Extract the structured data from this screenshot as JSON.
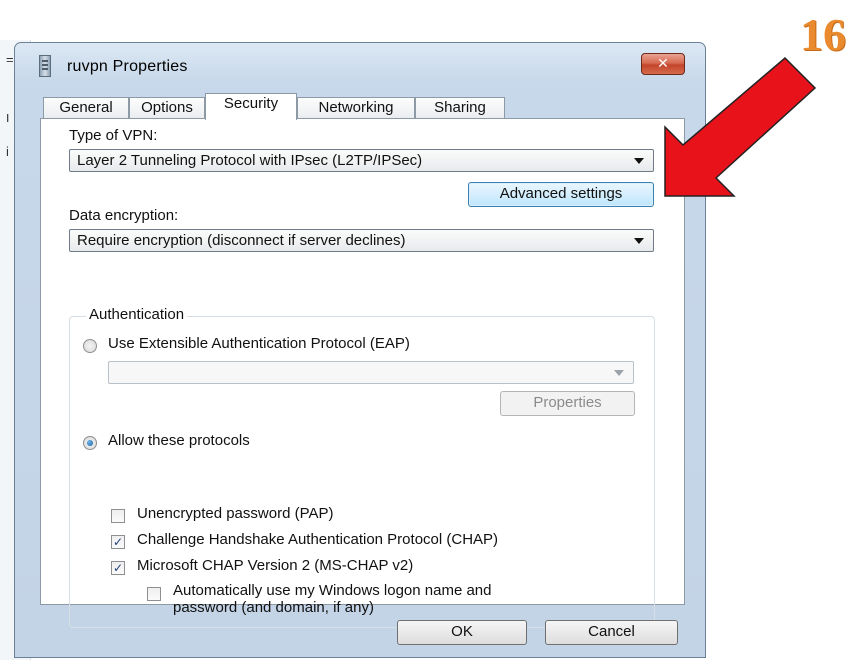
{
  "window": {
    "title": "ruvpn Properties",
    "close_symbol": "✕"
  },
  "tabs": [
    "General",
    "Options",
    "Security",
    "Networking",
    "Sharing"
  ],
  "active_tab": "Security",
  "security": {
    "type_of_vpn_label": "Type of VPN:",
    "type_of_vpn_value": "Layer 2 Tunneling Protocol with IPsec (L2TP/IPSec)",
    "advanced_settings_label": "Advanced settings",
    "data_encryption_label": "Data encryption:",
    "data_encryption_value": "Require encryption (disconnect if server declines)",
    "authentication": {
      "legend": "Authentication",
      "eap_option_label": "Use Extensible Authentication Protocol (EAP)",
      "eap_selected": false,
      "eap_dropdown_value": "",
      "properties_label": "Properties",
      "allow_protocols_label": "Allow these protocols",
      "allow_protocols_selected": true,
      "protocols": [
        {
          "label": "Unencrypted password (PAP)",
          "checked": false
        },
        {
          "label": "Challenge Handshake Authentication Protocol (CHAP)",
          "checked": true
        },
        {
          "label": "Microsoft CHAP Version 2 (MS-CHAP v2)",
          "checked": true
        }
      ],
      "auto_logon_line1": "Automatically use my Windows logon name and",
      "auto_logon_line2": "password (and domain, if any)",
      "auto_logon_checked": false
    }
  },
  "footer": {
    "ok_label": "OK",
    "cancel_label": "Cancel"
  },
  "annotation": {
    "step_number": "16",
    "arrow_color": "#e8121b"
  },
  "colors": {
    "step_number": "#e98a2e",
    "close_button": "#c3442a",
    "focus_button": "#bee6fd"
  },
  "background_marks": [
    "=",
    "ו",
    "i"
  ]
}
